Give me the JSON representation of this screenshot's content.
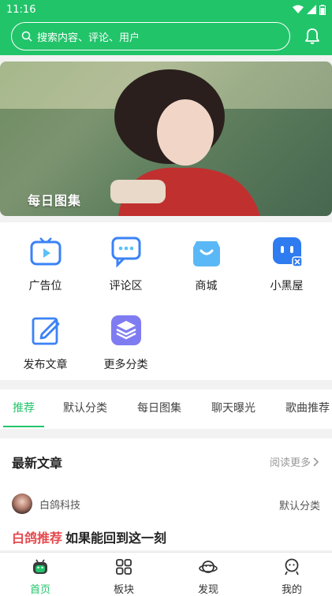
{
  "status": {
    "time": "11:16"
  },
  "header": {
    "search_placeholder": "搜索内容、评论、用户"
  },
  "banner": {
    "caption": "每日图集"
  },
  "grid": [
    {
      "label": "广告位",
      "icon": "tv-icon"
    },
    {
      "label": "评论区",
      "icon": "comment-icon"
    },
    {
      "label": "商城",
      "icon": "shopping-bag-icon"
    },
    {
      "label": "小黑屋",
      "icon": "blocked-chat-icon"
    },
    {
      "label": "发布文章",
      "icon": "edit-icon"
    },
    {
      "label": "更多分类",
      "icon": "layers-icon"
    }
  ],
  "tabs": [
    "推荐",
    "默认分类",
    "每日图集",
    "聊天曝光",
    "歌曲推荐"
  ],
  "latest": {
    "title": "最新文章",
    "more": "阅读更多",
    "author": "白鸽科技",
    "category": "默认分类",
    "tag": "白鸽推荐",
    "article_title": "如果能回到这一刻"
  },
  "nav": [
    {
      "label": "首页",
      "icon": "home-robot-icon"
    },
    {
      "label": "板块",
      "icon": "grid-icon"
    },
    {
      "label": "发现",
      "icon": "planet-icon"
    },
    {
      "label": "我的",
      "icon": "profile-icon"
    }
  ],
  "colors": {
    "accent": "#22c46a",
    "tag_red": "#e5484d",
    "icon_blue": "#3b82f6"
  }
}
